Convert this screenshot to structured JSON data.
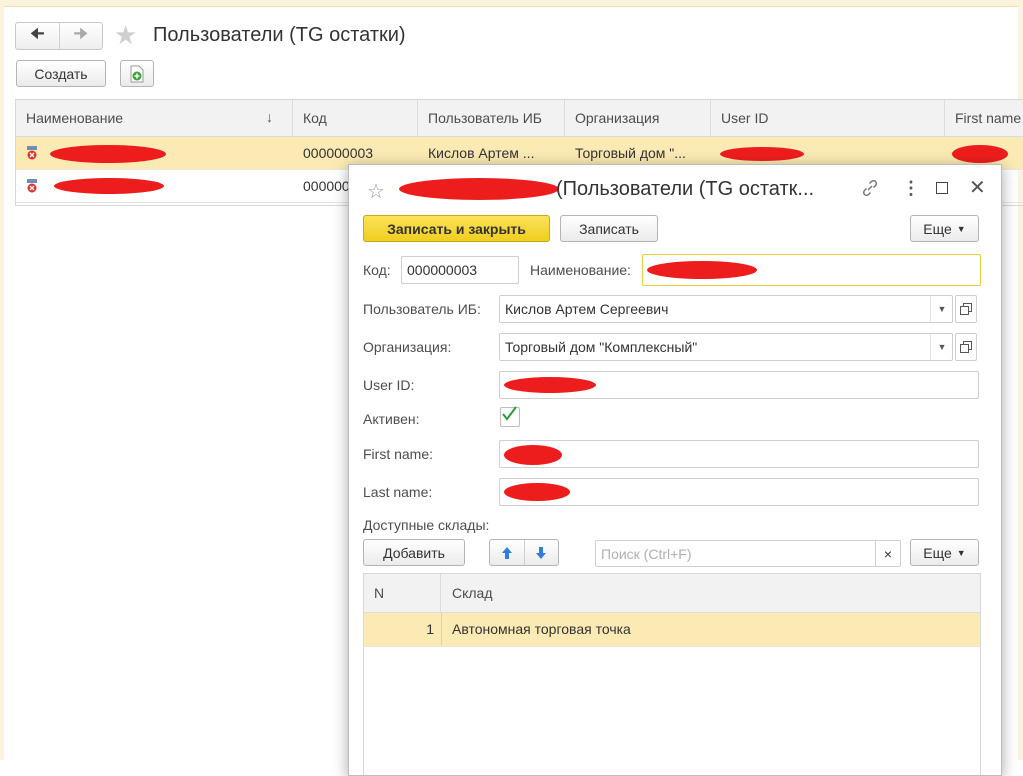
{
  "colors": {
    "accent_yellow": "#f5d73a",
    "selected_row": "#fbeab3",
    "redaction": "#ee1d1d",
    "check_green": "#2e9b3a"
  },
  "window": {
    "title": "Пользователи (TG остатки)",
    "nav": {
      "back_icon": "arrow-left-icon",
      "forward_icon": "arrow-right-icon",
      "favorite_icon": "star-icon"
    },
    "toolbar": {
      "create_label": "Создать",
      "add_icon": "add-green-icon"
    }
  },
  "list": {
    "columns": [
      "Наименование",
      "↓",
      "Код",
      "Пользователь ИБ",
      "Организация",
      "User ID",
      "First name"
    ],
    "rows": [
      {
        "code": "000000003",
        "ib_user": "Кислов Артем ...",
        "organization": "Торговый дом \"...",
        "selected": true
      },
      {
        "code": "000000",
        "ib_user": "",
        "organization": "",
        "selected": false
      }
    ]
  },
  "dialog": {
    "title_suffix": "(Пользователи (TG остатк...",
    "icons": [
      "star-icon",
      "link-icon",
      "more-icon",
      "maximize-icon",
      "close-icon"
    ],
    "buttons": {
      "save_close": "Записать и закрыть",
      "save": "Записать",
      "more": "Еще"
    },
    "fields": {
      "code_label": "Код:",
      "code_value": "000000003",
      "name_label": "Наименование:",
      "ib_user_label": "Пользователь ИБ:",
      "ib_user_value": "Кислов Артем Сергеевич",
      "org_label": "Организация:",
      "org_value": "Торговый дом \"Комплексный\"",
      "user_id_label": "User ID:",
      "active_label": "Активен:",
      "active_checked": true,
      "first_name_label": "First name:",
      "last_name_label": "Last name:"
    },
    "warehouses": {
      "section_label": "Доступные склады:",
      "add_label": "Добавить",
      "search_placeholder": "Поиск (Ctrl+F)",
      "clear_icon": "×",
      "more_label": "Еще",
      "columns": [
        "N",
        "Склад"
      ],
      "rows": [
        {
          "n": "1",
          "name": "Автономная торговая точка"
        }
      ]
    }
  }
}
